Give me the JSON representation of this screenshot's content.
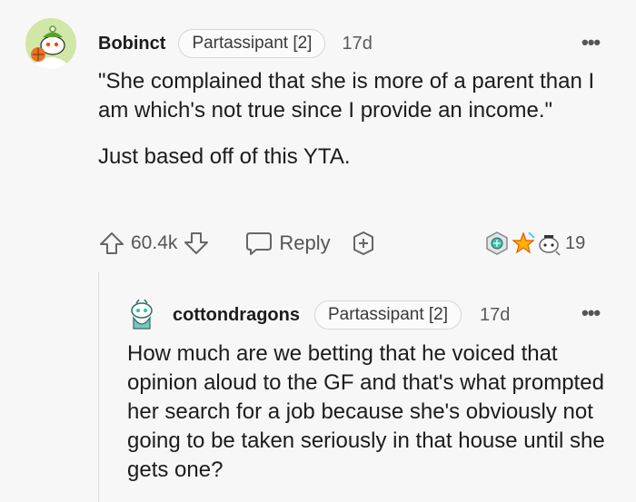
{
  "comment": {
    "username": "Bobinct",
    "flair": "Partassipant [2]",
    "age": "17d",
    "more": "•••",
    "paragraphs": [
      "\"She complained that she is more of a parent than I am which's not true since I provide an income.\"",
      "Just based off of this YTA."
    ],
    "score": "60.4k",
    "reply_label": "Reply",
    "award_count": "19"
  },
  "reply": {
    "username": "cottondragons",
    "flair": "Partassipant [2]",
    "age": "17d",
    "more": "•••",
    "body": "How much are we betting that he voiced that opinion aloud to the GF and that's what prompted her search for a job because she's obviously not going to be taken seriously in that house until she gets one?"
  },
  "icons": {
    "upvote": "upvote-icon",
    "downvote": "downvote-icon",
    "reply": "speech-bubble-icon",
    "award": "add-award-icon",
    "accent": "#ff4500"
  }
}
